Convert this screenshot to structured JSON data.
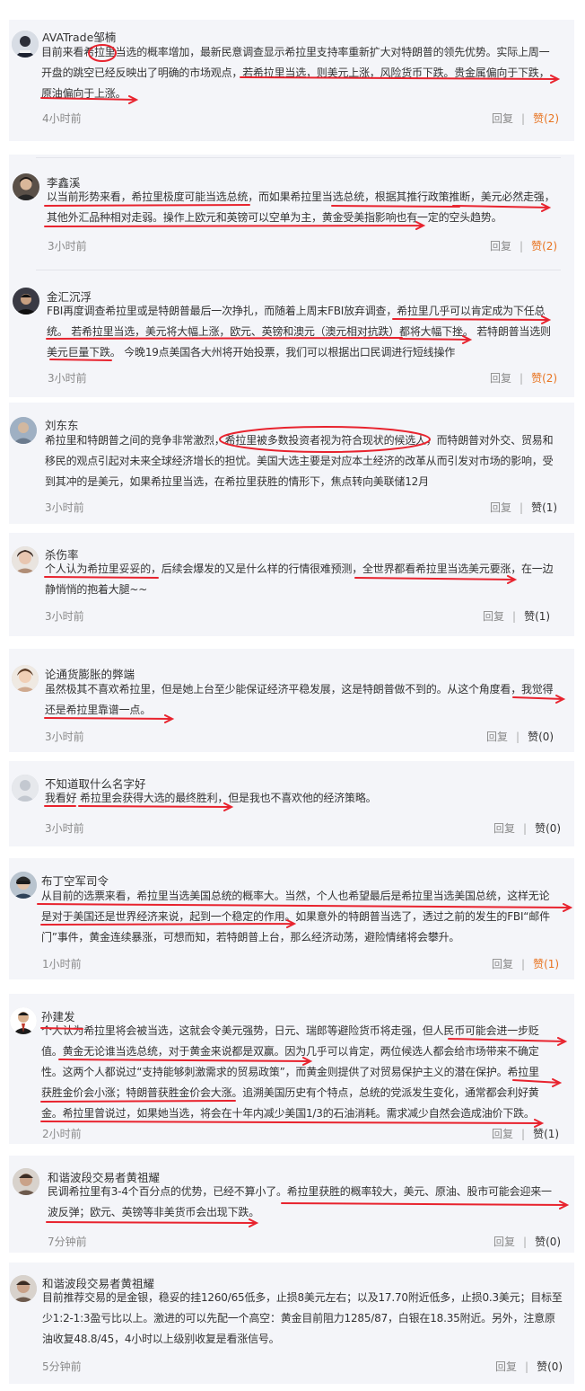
{
  "reply_label": "回复",
  "comments": [
    {
      "name": "AVATrade邹楠",
      "lines": [
        "目前来看希拉里当选的概率增加，最新民意调查显示希拉里支持率重新扩大对特朗普的领先优势。实际上周一",
        "开盘的跳空已经反映出了明确的市场观点，若希拉里当选，则美元上涨，风险货币下跌。贵金属偏向于下跌，",
        "原油偏向于上涨。"
      ],
      "time": "4小时前",
      "like": "赞(2)",
      "liked": true
    },
    {
      "name": "李鑫溪",
      "lines": [
        "以当前形势来看，希拉里极度可能当选总统，而如果希拉里当选总统，根据其推行政策推断，美元必然走强，",
        "其他外汇品种相对走弱。操作上欧元和英镑可以空单为主，黄金受美指影响也有一定的空头趋势。"
      ],
      "time": "3小时前",
      "like": "赞(2)",
      "liked": true
    },
    {
      "name": "金汇沉浮",
      "lines": [
        "FBI再度调查希拉里或是特朗普最后一次挣扎，而随着上周末FBI放弃调查，希拉里几乎可以肯定成为下任总",
        "统。 若希拉里当选，美元将大幅上涨，欧元、英镑和澳元（澳元相对抗跌）都将大幅下挫。 若特朗普当选则",
        "美元巨量下跌。 今晚19点美国各大州将开始投票，我们可以根据出口民调进行短线操作"
      ],
      "time": "3小时前",
      "like": "赞(2)",
      "liked": true
    },
    {
      "name": "刘东东",
      "lines": [
        "希拉里和特朗普之间的竞争非常激烈，希拉里被多数投资者视为符合现状的候选人，而特朗普对外交、贸易和",
        "移民的观点引起对未来全球经济增长的担忧。美国大选主要是对应本土经济的改革从而引发对市场的影响，受",
        "到其冲的是美元，如果希拉里当选，在希拉里获胜的情形下，焦点转向美联储12月"
      ],
      "time": "3小时前",
      "like": "赞(1)",
      "liked": false
    },
    {
      "name": "杀伤率",
      "lines": [
        "个人认为希拉里妥妥的，后续会爆发的又是什么样的行情很难预测，全世界都看希拉里当选美元要涨，在一边",
        "静悄悄的抱着大腿~~"
      ],
      "time": "3小时前",
      "like": "赞(1)",
      "liked": false
    },
    {
      "name": "论通货膨胀的弊端",
      "lines": [
        "虽然极其不喜欢希拉里，但是她上台至少能保证经济平稳发展，这是特朗普做不到的。从这个角度看，我觉得",
        "还是希拉里靠谱一点。"
      ],
      "time": "3小时前",
      "like": "赞(0)",
      "liked": false
    },
    {
      "name": "不知道取什么名字好",
      "lines": [
        "我看好 希拉里会获得大选的最终胜利，但是我也不喜欢他的经济策略。"
      ],
      "time": "3小时前",
      "like": "赞(0)",
      "liked": false
    },
    {
      "name": "布丁空军司令",
      "lines": [
        "从目前的选票来看，希拉里当选美国总统的概率大。当然，个人也希望最后是希拉里当选美国总统，这样无论",
        "是对于美国还是世界经济来说，起到一个稳定的作用。如果意外的特朗普当选了，透过之前的发生的FBI“邮件",
        "门”事件，黄金连续暴涨，可想而知，若特朗普上台，那么经济动荡，避险情绪将会攀升。"
      ],
      "time": "1小时前",
      "like": "赞(1)",
      "liked": true
    },
    {
      "name": "孙建发",
      "lines": [
        "个人认为希拉里将会被当选，这就会令美元强势，日元、瑞郎等避险货币将走强，但人民币可能会进一步贬",
        "值。黄金无论谁当选总统，对于黄金来说都是双赢。因为几乎可以肯定，两位候选人都会给市场带来不确定",
        "性。这两个人都说过“支持能够刺激需求的贸易政策”，而黄金则提供了对贸易保护主义的潜在保护。希拉里",
        "获胜金价会小涨；特朗普获胜金价会大涨。追溯美国历史有个特点，总统的党派发生变化，通常都会利好黄",
        "金。希拉里曾说过，如果她当选，将会在十年内减少美国1/3的石油消耗。需求减少自然会造成油价下跌。"
      ],
      "time": "2小时前",
      "like": "赞(1)",
      "liked": false
    },
    {
      "name": "和谐波段交易者黄祖耀",
      "lines": [
        "民调希拉里有3-4个百分点的优势，已经不算小了。希拉里获胜的概率较大，美元、原油、股市可能会迎来一",
        "波反弹；欧元、英镑等非美货币会出现下跌。"
      ],
      "time": "7分钟前",
      "like": "赞(0)",
      "liked": false
    },
    {
      "name": "和谐波段交易者黄祖耀",
      "lines": [
        "目前推荐交易的是金银，稳妥的挂1260/65低多，止损8美元左右；以及17.70附近低多，止损0.3美元；目标至",
        "少1:2-1:3盈亏比以上。激进的可以先配一个高空：黄金目前阻力1285/87，白银在18.35附近。另外，注意原",
        "油收复48.8/45，4小时以上级别收复是看涨信号。"
      ],
      "time": "5分钟前",
      "like": "赞(0)",
      "liked": false
    }
  ]
}
